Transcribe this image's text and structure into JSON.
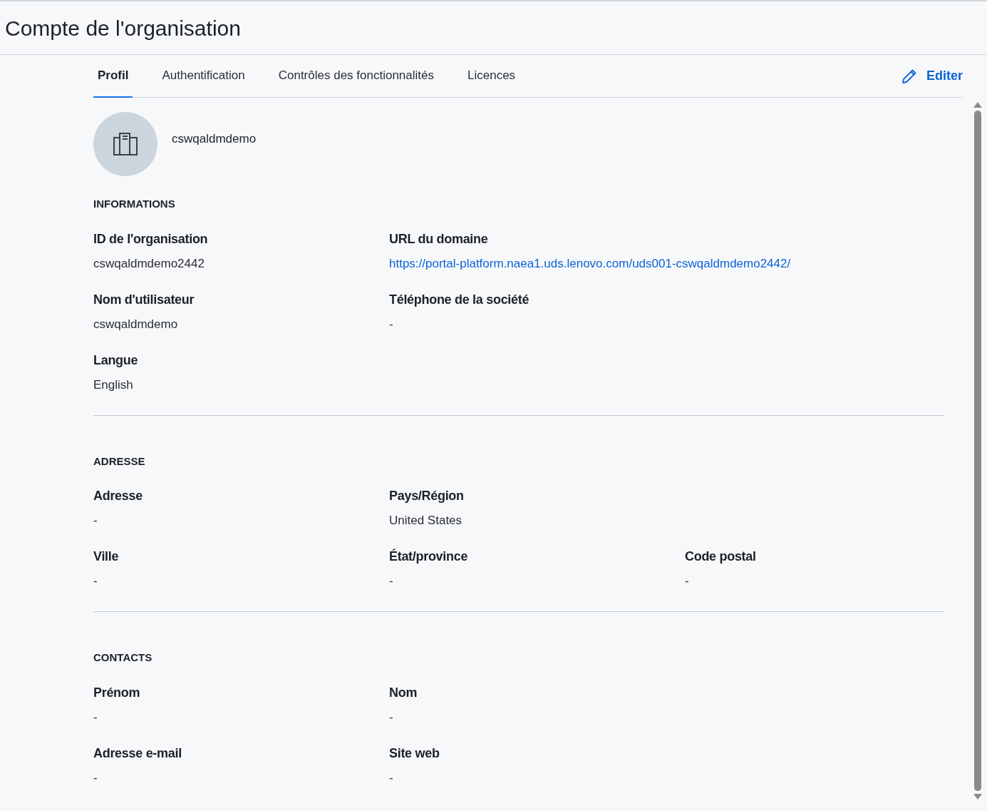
{
  "page_title": "Compte de l'organisation",
  "tabs": [
    {
      "label": "Profil",
      "selected": true
    },
    {
      "label": "Authentification",
      "selected": false
    },
    {
      "label": "Contrôles des fonctionnalités",
      "selected": false
    },
    {
      "label": "Licences",
      "selected": false
    }
  ],
  "edit_button": "Editer",
  "organization_name": "cswqaldmdemo",
  "sections": [
    {
      "title": "INFORMATIONS",
      "rows": [
        [
          {
            "label": "ID de l'organisation",
            "value": "cswqaldmdemo2442",
            "kind": "text"
          },
          {
            "label": "URL du domaine",
            "value": "https://portal-platform.naea1.uds.lenovo.com/uds001-cswqaldmdemo2442/",
            "kind": "link"
          }
        ],
        [
          {
            "label": "Nom d'utilisateur",
            "value": "cswqaldmdemo",
            "kind": "text"
          },
          {
            "label": "Téléphone de la société",
            "value": "-",
            "kind": "text"
          }
        ],
        [
          {
            "label": "Langue",
            "value": "English",
            "kind": "text"
          }
        ]
      ]
    },
    {
      "title": "ADRESSE",
      "rows": [
        [
          {
            "label": "Adresse",
            "value": "-",
            "kind": "text"
          },
          {
            "label": "Pays/Région",
            "value": "United States",
            "kind": "text"
          }
        ],
        [
          {
            "label": "Ville",
            "value": "-",
            "kind": "text"
          },
          {
            "label": "État/province",
            "value": "-",
            "kind": "text"
          },
          {
            "label": "Code postal",
            "value": "-",
            "kind": "text"
          }
        ]
      ]
    },
    {
      "title": "CONTACTS",
      "rows": [
        [
          {
            "label": "Prénom",
            "value": "-",
            "kind": "text"
          },
          {
            "label": "Nom",
            "value": "-",
            "kind": "text"
          }
        ],
        [
          {
            "label": "Adresse e-mail",
            "value": "-",
            "kind": "text"
          },
          {
            "label": "Site web",
            "value": "-",
            "kind": "text"
          }
        ]
      ]
    }
  ]
}
